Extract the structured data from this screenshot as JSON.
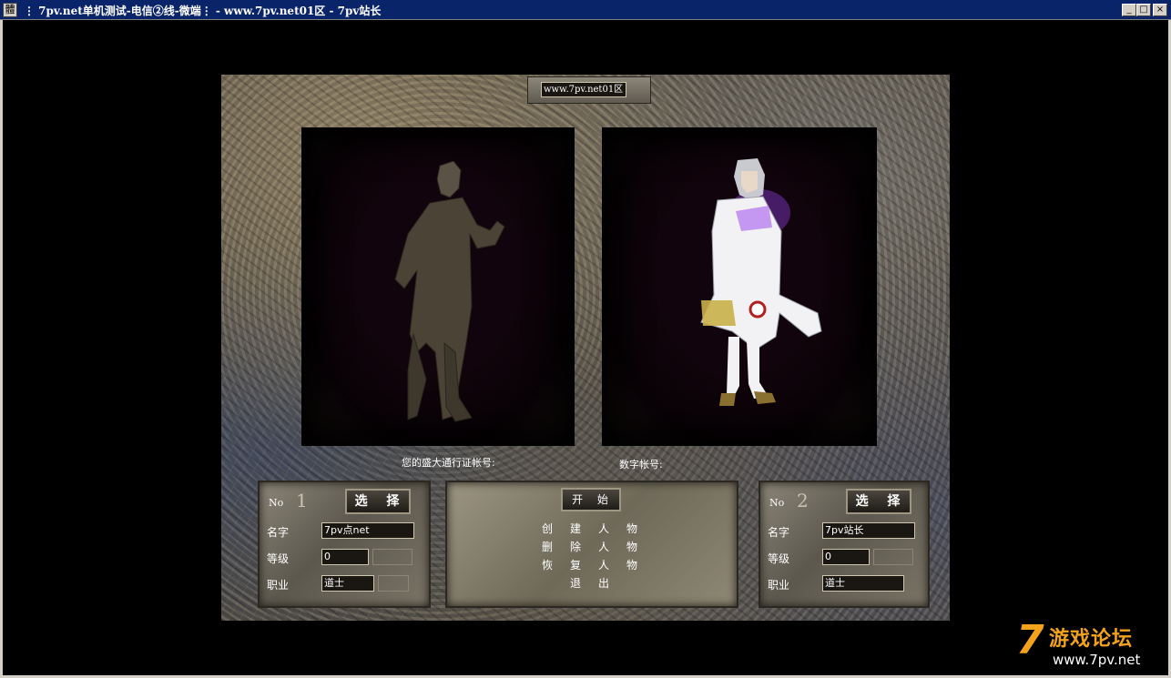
{
  "window": {
    "app_icon_glyph": "體",
    "title": "⋮ 7pv.net单机测试-电信②线-微端⋮ - www.7pv.net01区 - 7pv站长",
    "controls": {
      "minimize": "_",
      "maximize": "□",
      "close": "×"
    }
  },
  "server": {
    "name": "www.7pv.net01区"
  },
  "account": {
    "passport_label": "您的盛大通行证帐号:",
    "numeric_label": "数字帐号:"
  },
  "slots": [
    {
      "no_label": "No",
      "number": "1",
      "select_label": "选 择",
      "name_label": "名字",
      "name": "7pv点net",
      "level_label": "等级",
      "level": "0",
      "class_label": "职业",
      "class": "道士"
    },
    {
      "no_label": "No",
      "number": "2",
      "select_label": "选 择",
      "name_label": "名字",
      "name": "7pv站长",
      "level_label": "等级",
      "level": "0",
      "class_label": "职业",
      "class": "道士"
    }
  ],
  "menu": {
    "start": "开 始",
    "create": "创建人物",
    "delete": "删除人物",
    "restore": "恢复人物",
    "exit": "退出"
  },
  "watermark": {
    "digit": "7",
    "text": "游戏论坛",
    "url": "www.7pv.net"
  },
  "colors": {
    "title_bar": "#0a246a",
    "watermark_orange": "#f3a21b",
    "window_chrome": "#d4d0c8"
  }
}
